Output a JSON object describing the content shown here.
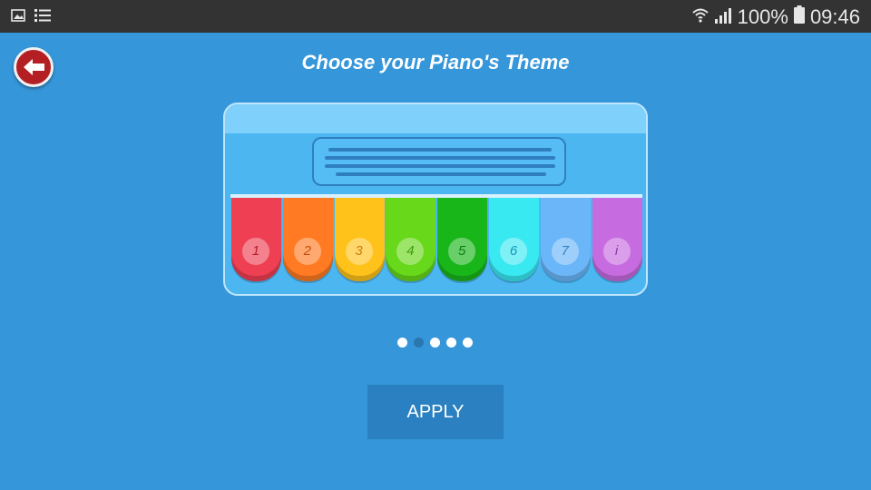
{
  "status_bar": {
    "left_icons": [
      "image-icon",
      "list-icon"
    ],
    "right_icons": [
      "wifi-icon",
      "signal-icon",
      "battery-icon"
    ],
    "battery": "100%",
    "time": "09:46"
  },
  "header": {
    "back_icon": "arrow-left-icon",
    "title": "Choose your Piano's Theme"
  },
  "piano": {
    "keys": [
      {
        "label": "1",
        "color": "#ef3f52",
        "text_color": "#b3202d"
      },
      {
        "label": "2",
        "color": "#ff7a22",
        "text_color": "#c24f0e"
      },
      {
        "label": "3",
        "color": "#ffc21b",
        "text_color": "#c97d0a"
      },
      {
        "label": "4",
        "color": "#67d81a",
        "text_color": "#3f9a0d"
      },
      {
        "label": "5",
        "color": "#19b61a",
        "text_color": "#0e7f10"
      },
      {
        "label": "6",
        "color": "#39e9f2",
        "text_color": "#1398b8"
      },
      {
        "label": "7",
        "color": "#6bb6f9",
        "text_color": "#2f7fbf"
      },
      {
        "label": "i",
        "color": "#c76be0",
        "text_color": "#8a3da6"
      }
    ]
  },
  "pager": {
    "count": 5,
    "active_index": 1
  },
  "apply_label": "APPLY"
}
